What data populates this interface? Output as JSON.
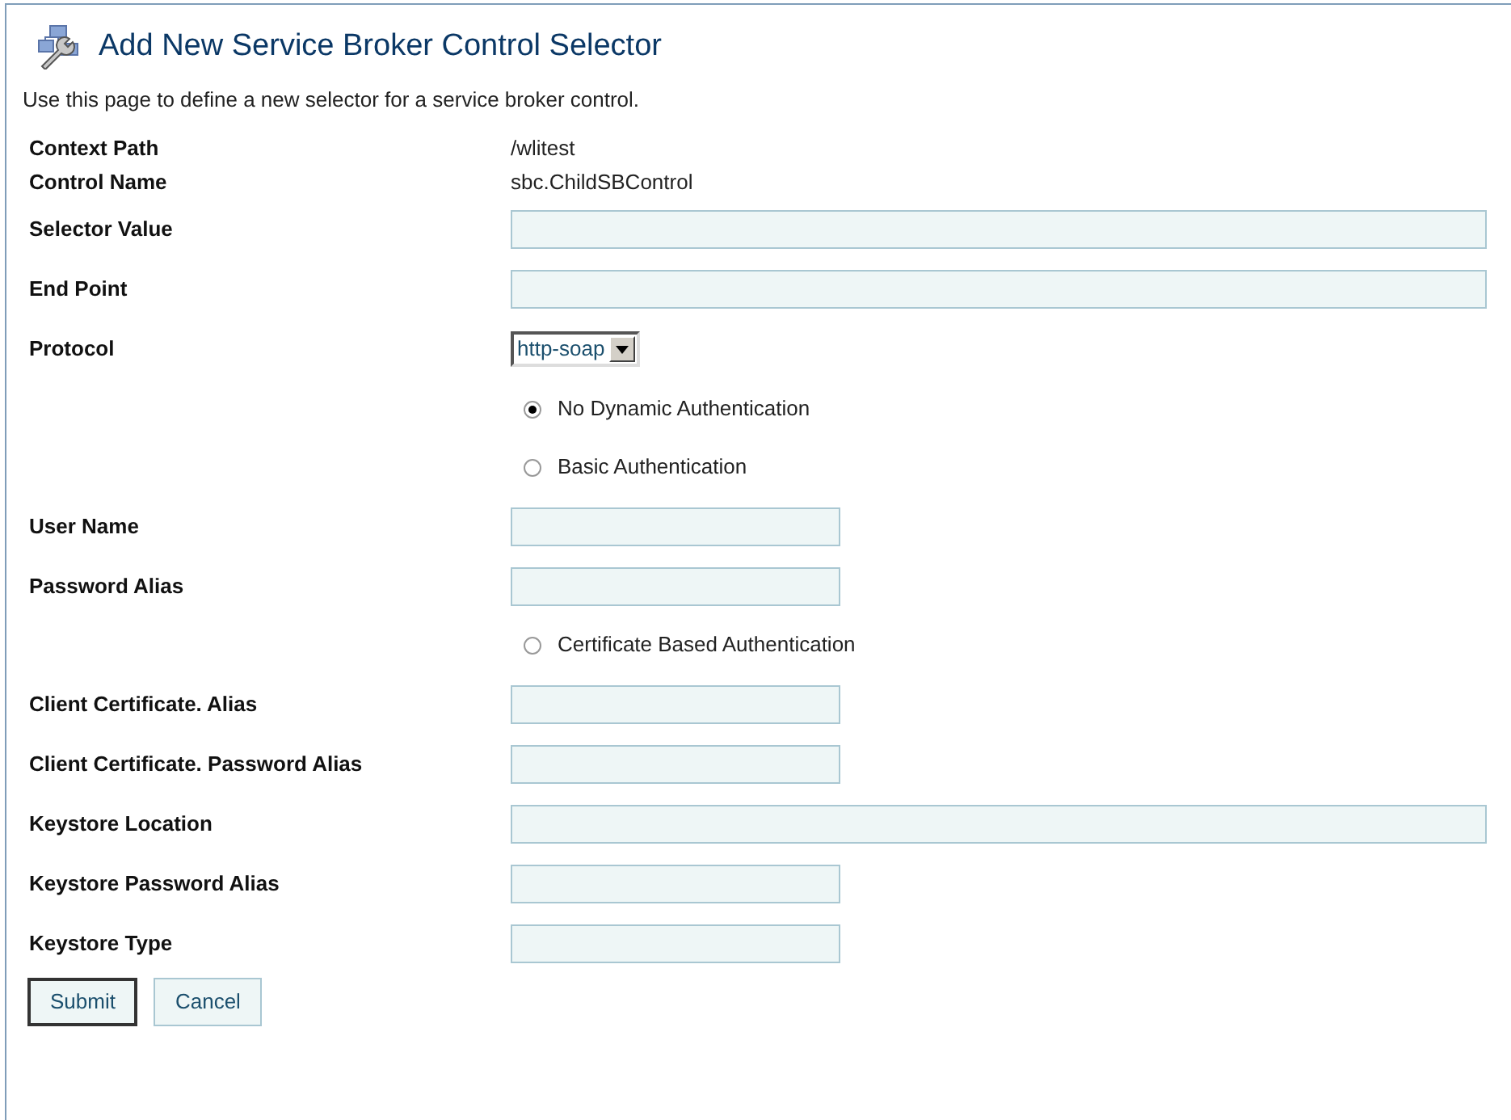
{
  "page": {
    "title": "Add New Service Broker Control Selector",
    "description": "Use this page to define a new selector for a service broker control."
  },
  "rows": [
    {
      "kind": "text",
      "label": "Context Path",
      "value": "/wlitest"
    },
    {
      "kind": "text",
      "label": "Control Name",
      "value": "sbc.ChildSBControl"
    },
    {
      "kind": "long_field",
      "label": "Selector Value"
    },
    {
      "kind": "long_field",
      "label": "End Point"
    },
    {
      "kind": "select",
      "label": "Protocol",
      "value": "http-soap"
    },
    {
      "kind": "radio",
      "label": "No Dynamic Authentication",
      "selected": true
    },
    {
      "kind": "radio",
      "label": "Basic Authentication",
      "selected": false
    },
    {
      "kind": "short_field",
      "label": "User Name"
    },
    {
      "kind": "short_field",
      "label": "Password Alias"
    },
    {
      "kind": "radio",
      "label": "Certificate Based Authentication",
      "selected": false
    },
    {
      "kind": "short_field",
      "label": "Client Certificate. Alias"
    },
    {
      "kind": "short_field",
      "label": "Client Certificate. Password Alias"
    },
    {
      "kind": "long_field",
      "label": "Keystore Location"
    },
    {
      "kind": "short_field",
      "label": "Keystore Password Alias"
    },
    {
      "kind": "short_field",
      "label": "Keystore Type"
    }
  ],
  "buttons": [
    {
      "label": "Submit",
      "default": true
    },
    {
      "label": "Cancel",
      "default": false
    }
  ]
}
